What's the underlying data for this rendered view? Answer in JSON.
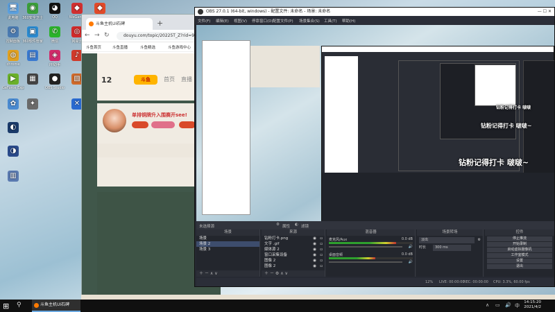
{
  "desktop": {
    "icons": [
      {
        "label": "此电脑",
        "glyph": "🖥",
        "color": "#5aa0e0"
      },
      {
        "label": "360安全卫士",
        "glyph": "◉",
        "color": "#3a9e3a"
      },
      {
        "label": "QQ",
        "glyph": "◕",
        "color": "#111111"
      },
      {
        "label": "WeGame",
        "glyph": "◆",
        "color": "#d03030"
      },
      {
        "label": "",
        "glyph": "◆",
        "color": "#e04a2a"
      },
      {
        "label": "控制面板",
        "glyph": "⚙",
        "color": "#4a7ab0"
      },
      {
        "label": "360软件管家",
        "glyph": "▣",
        "color": "#2a8ad0"
      },
      {
        "label": "微信",
        "glyph": "✆",
        "color": "#2ab32a"
      },
      {
        "label": "网易云",
        "glyph": "◎",
        "color": "#d02a2a"
      },
      {
        "label": "chrome",
        "glyph": "◍",
        "color": "#e0a020"
      },
      {
        "label": "",
        "glyph": "▤",
        "color": "#3a7ad0"
      },
      {
        "label": "PP助手",
        "glyph": "◈",
        "color": "#d02a6a"
      },
      {
        "label": "",
        "glyph": "♪",
        "color": "#cf3a2a"
      },
      {
        "label": "GeForce Experience",
        "glyph": "▶",
        "color": "#6ab02a"
      },
      {
        "label": "",
        "glyph": "▦",
        "color": "#444444"
      },
      {
        "label": "OBS Studio",
        "glyph": "●",
        "color": "#222222"
      },
      {
        "label": "",
        "glyph": "▧",
        "color": "#d06a2a"
      },
      {
        "label": "",
        "glyph": "✿",
        "color": "#4a8ad0"
      },
      {
        "label": "",
        "glyph": "✦",
        "color": "#6a6a6a"
      },
      {
        "label": "",
        "glyph": "✕",
        "color": "#2a6ad0"
      },
      {
        "label": "",
        "glyph": "◐",
        "color": "#1a3a6a"
      },
      {
        "label": "",
        "glyph": "◑",
        "color": "#2a4a8a"
      },
      {
        "label": "",
        "glyph": "▥",
        "color": "#5a7ab0"
      }
    ]
  },
  "browser": {
    "tab_title": "斗鱼主机UI石碑",
    "new_tab": "+",
    "url": "douyu.com/topic/20225T_Z?rid=99",
    "bookmarks": [
      "斗鱼首页",
      "斗鱼直播",
      "斗鱼精选",
      "斗鱼游戏中心"
    ],
    "page": {
      "num": "12",
      "num_sub": "",
      "logo": "斗鱼",
      "nav1": "首页",
      "nav2": "直播",
      "card_title": "单排铜牌升入围赛开see!",
      "chips": [
        {
          "label": "",
          "color": "#d94a2a"
        },
        {
          "label": "",
          "color": "#e0708a"
        },
        {
          "label": "",
          "color": "#d94a2a"
        }
      ]
    }
  },
  "obs": {
    "title": "OBS 27.0.1 (64-bit, windows) - 配置文件: 未命名 - 场景: 未命名",
    "win_ctrl": "— ☐ ✕",
    "menu": [
      "文件(F)",
      "编辑(E)",
      "视图(V)",
      "停靠窗口(D)",
      "配置文件(P)",
      "场景集合(S)",
      "工具(T)",
      "帮助(H)"
    ],
    "context_bar": "未选择源",
    "context_props": "属性",
    "context_filters": "滤镜",
    "overlay_texts": {
      "large": "钻粉记得打卡 啵啵~",
      "medium": "钻粉记得打卡 啵啵~",
      "small": "钻粉记得打卡 啵啵"
    },
    "docks": {
      "scenes": {
        "header": "场景",
        "items": [
          "场景",
          "场景 2",
          "场景 3"
        ],
        "selected": 1
      },
      "sources": {
        "header": "来源",
        "items": [
          "钻粉打卡.png",
          "文字 .gif",
          "媒体源 2",
          "窗口采集设备",
          "图像 2",
          "图像 2"
        ]
      },
      "mixer": {
        "header": "混音器",
        "channels": [
          {
            "name": "麦克风/Aux",
            "db": "0.0 dB",
            "level": 0.8
          },
          {
            "name": "桌面音频",
            "db": "0.0 dB",
            "level": 0.55
          }
        ]
      },
      "transitions": {
        "header": "场景转场",
        "type": "淡出",
        "duration_label": "时长",
        "duration": "300 ms"
      },
      "controls": {
        "header": "控件",
        "buttons": [
          "停止推流",
          "开始录制",
          "启动虚拟摄像机",
          "工作室模式",
          "设置",
          "退出"
        ]
      }
    },
    "status": {
      "live": "LIVE: 00:00:00",
      "rec": "REC: 00:00:00",
      "cpu": "CPU: 3.3%, 60.00 fps",
      "bitrate": "12%"
    }
  },
  "taskbar": {
    "start": "⊞",
    "search": "⚲",
    "app_title": "斗鱼主机UI石碑",
    "tray_icons": [
      "∧",
      "▭",
      "🔊",
      "中"
    ],
    "time": "14:15:20",
    "date": "2021/4/2"
  }
}
